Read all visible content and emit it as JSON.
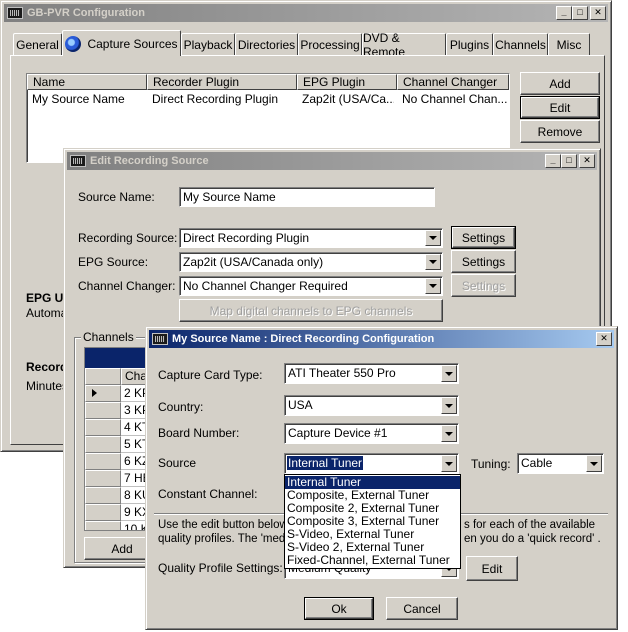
{
  "main_window": {
    "title": "GB-PVR Configuration",
    "tabs": [
      "General",
      "Capture Sources",
      "Playback",
      "Directories",
      "Processing",
      "DVD & Remote",
      "Plugins",
      "Channels",
      "Misc"
    ],
    "selected_tab": "Capture Sources",
    "list": {
      "headers": [
        "Name",
        "Recorder Plugin",
        "EPG Plugin",
        "Channel Changer"
      ],
      "rows": [
        [
          "My Source Name",
          "Direct Recording Plugin",
          "Zap2it (USA/Ca...",
          "No Channel Chan..."
        ]
      ]
    },
    "buttons": {
      "add": "Add",
      "edit": "Edit",
      "remove": "Remove"
    },
    "epg_heading": "EPG Up",
    "epg_text": "Automat",
    "record_heading": "Record",
    "record_text": "Minutes"
  },
  "edit_window": {
    "title": "Edit Recording Source",
    "source_name_label": "Source Name:",
    "source_name_value": "My Source Name",
    "recording_source_label": "Recording Source:",
    "recording_source_value": "Direct Recording Plugin",
    "epg_source_label": "EPG Source:",
    "epg_source_value": "Zap2it (USA/Canada only)",
    "channel_changer_label": "Channel Changer:",
    "channel_changer_value": "No Channel Changer Required",
    "settings_label": "Settings",
    "map_button": "Map digital channels to EPG channels",
    "channels_group": "Channels",
    "channels_header": "Chan",
    "channels": [
      "2 KP",
      "3 KP",
      "4 KT",
      "5 KT",
      "6 KZ",
      "7 HB",
      "8 KU",
      "9 KX",
      "10 K"
    ],
    "add_button": "Add"
  },
  "config_window": {
    "title": "My Source Name : Direct Recording Configuration",
    "capture_card_label": "Capture Card Type:",
    "capture_card_value": "ATI Theater 550 Pro",
    "country_label": "Country:",
    "country_value": "USA",
    "board_label": "Board Number:",
    "board_value": "Capture Device #1",
    "source_label": "Source",
    "source_value": "Internal Tuner",
    "tuning_label": "Tuning:",
    "tuning_value": "Cable",
    "constant_channel_label": "Constant Channel:",
    "desc_line1_a": "Use the edit button below",
    "desc_line1_b": "s for each of the available",
    "desc_line2_a": "quality profiles. The 'mediu",
    "desc_line2_b": "en you do a 'quick record' .",
    "quality_label": "Quality Profile Settings:",
    "quality_value": "Medium Quality",
    "edit_button": "Edit",
    "ok_button": "Ok",
    "cancel_button": "Cancel",
    "source_options": [
      "Internal Tuner",
      "Composite, External Tuner",
      "Composite 2, External Tuner",
      "Composite 3, External Tuner",
      "S-Video, External Tuner",
      "S-Video 2, External Tuner",
      "Fixed-Channel, External Tuner"
    ]
  },
  "colors": {
    "face": "#d4d0c8",
    "active_title": "#0a246a",
    "inactive_title": "#808080",
    "highlight": "#0a246a"
  }
}
